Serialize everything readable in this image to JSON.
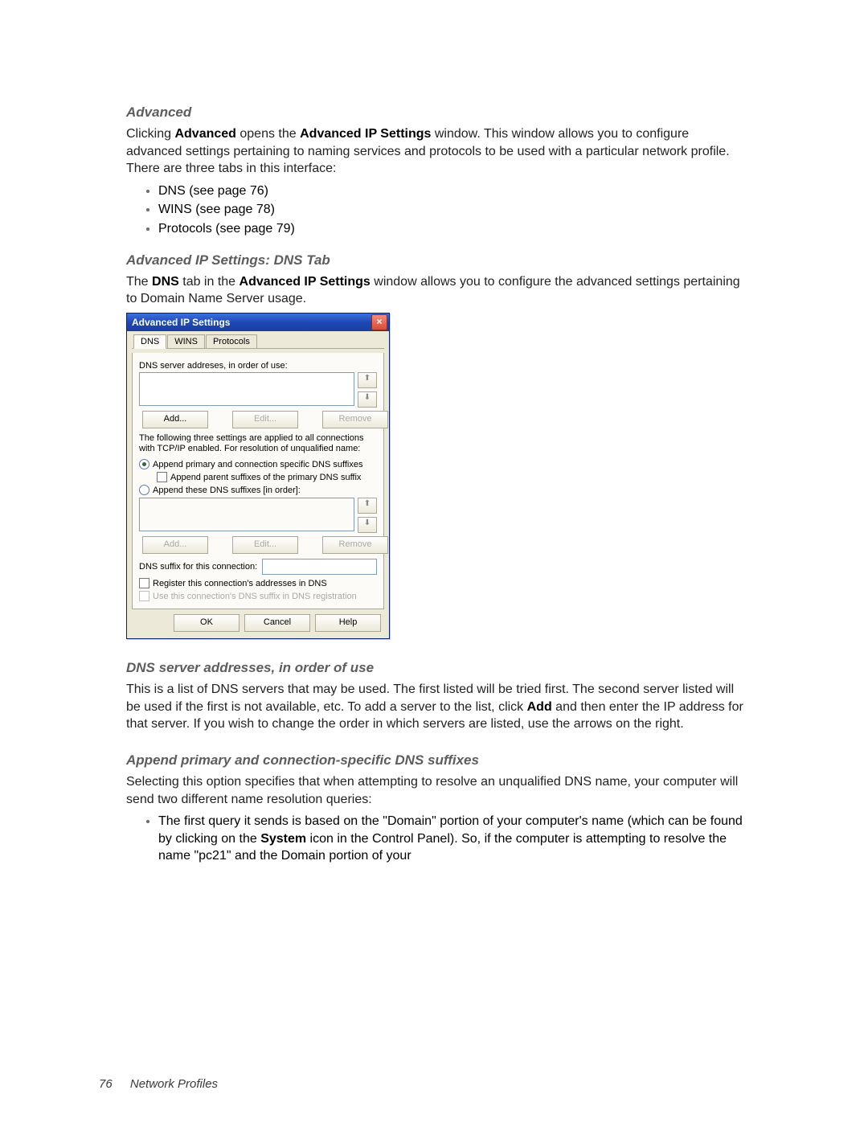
{
  "section1": {
    "heading": "Advanced",
    "para_pre": "Clicking ",
    "bold1": "Advanced",
    "para_mid1": " opens the ",
    "bold2": "Advanced IP Settings",
    "para_post": " window. This window allows you to configure advanced settings pertaining to naming services and protocols to be used with a particular network profile. There are three tabs in this interface:",
    "bullets": [
      "DNS (see page 76)",
      "WINS (see page 78)",
      "Protocols (see page 79)"
    ]
  },
  "section2": {
    "heading": "Advanced IP Settings: DNS Tab",
    "para_pre": "The ",
    "bold1": "DNS",
    "para_mid1": " tab in the ",
    "bold2": "Advanced IP Settings",
    "para_post": " window allows you to configure the advanced settings pertaining to Domain Name Server usage."
  },
  "dialog": {
    "title": "Advanced IP Settings",
    "tabs": [
      "DNS",
      "WINS",
      "Protocols"
    ],
    "label_servers": "DNS server addreses, in order of use:",
    "btn_add": "Add...",
    "btn_edit": "Edit...",
    "btn_remove": "Remove",
    "note": "The following three settings are applied to all connections with TCP/IP enabled. For resolution of unqualified name:",
    "radio1": "Append primary and connection specific DNS suffixes",
    "check_parent": "Append parent suffixes of the primary DNS suffix",
    "radio2": "Append these DNS suffixes [in order]:",
    "suffix_label": "DNS suffix for this connection:",
    "check_register": "Register this connection's addresses in DNS",
    "check_use": "Use this connection's DNS suffix in DNS registration",
    "btn_ok": "OK",
    "btn_cancel": "Cancel",
    "btn_help": "Help"
  },
  "section3": {
    "heading": "DNS server addresses, in order of use",
    "para_pre": "This is a list of DNS servers that may be used. The first listed will be tried first. The second server listed will be used if the first is not available, etc. To add a server to the list, click ",
    "bold1": "Add",
    "para_post": " and then enter the IP address for that server. If you wish to change the order in which servers are listed, use the arrows on the right."
  },
  "section4": {
    "heading": "Append primary and connection-specific DNS suffixes",
    "para": "Selecting this option specifies that when attempting to resolve an unqualified DNS name, your computer will send two different name resolution queries:",
    "bullet_pre": "The first query it sends is based on the \"Domain\" portion of your computer's name (which can be found by clicking on the ",
    "bullet_bold": "System",
    "bullet_post": " icon in the Control Panel). So, if the computer is attempting to resolve the name \"pc21\" and the Domain portion of your"
  },
  "footer": {
    "page": "76",
    "title": "Network Profiles"
  }
}
